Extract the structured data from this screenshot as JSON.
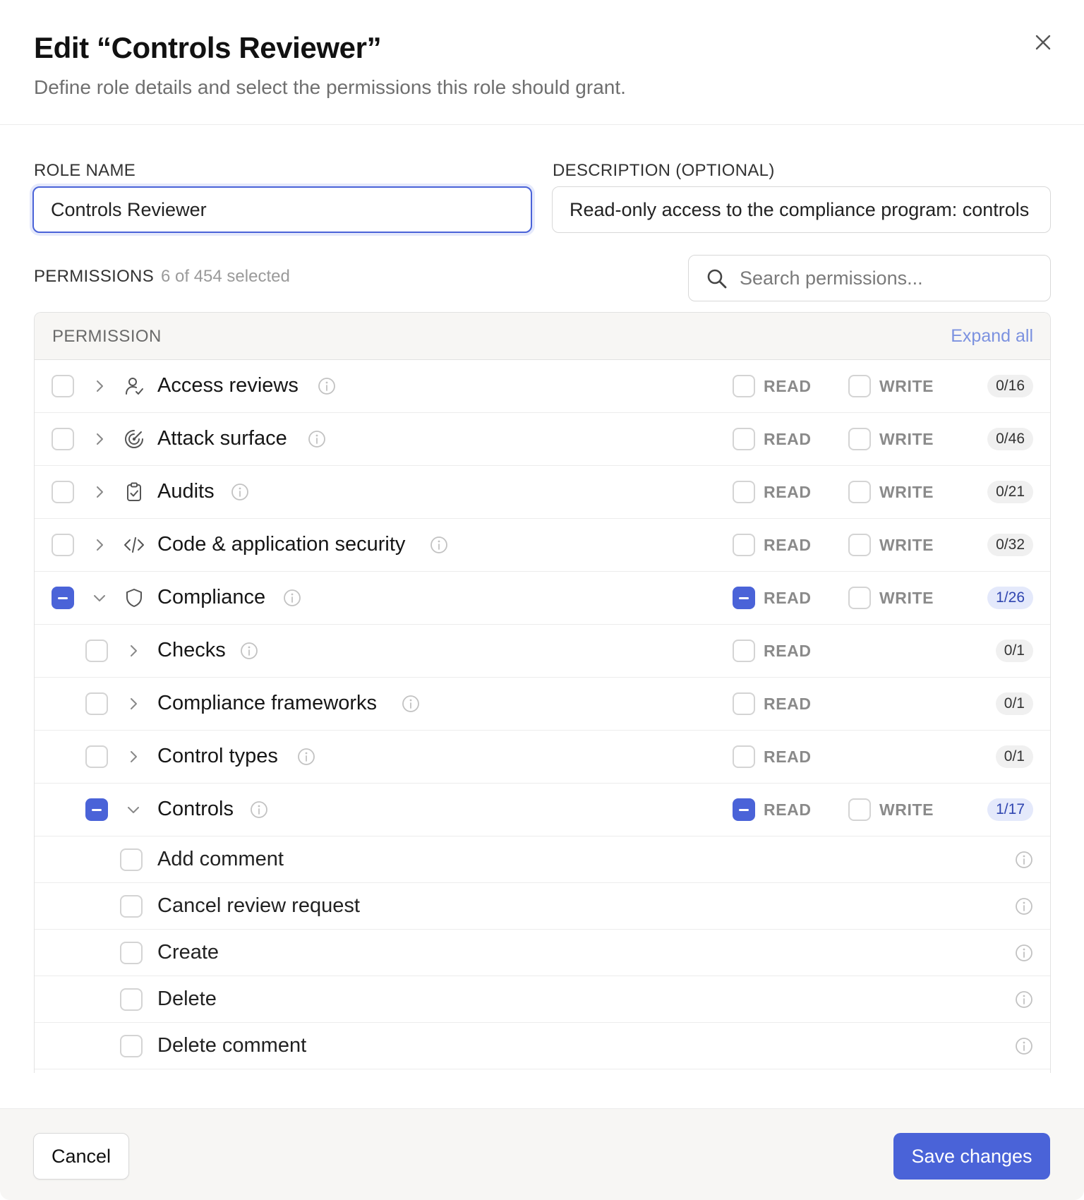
{
  "modal": {
    "title": "Edit “Controls Reviewer”",
    "subtitle": "Define role details and select the permissions this role should grant."
  },
  "form": {
    "role_name_label": "ROLE NAME",
    "role_name_value": "Controls Reviewer",
    "description_label": "DESCRIPTION (OPTIONAL)",
    "description_value": "Read-only access to the compliance program: controls"
  },
  "permissions": {
    "label": "PERMISSIONS",
    "selected_count": "6 of 454 selected",
    "search_placeholder": "Search permissions...",
    "column_header": "PERMISSION",
    "expand_all": "Expand all",
    "read_label": "READ",
    "write_label": "WRITE",
    "categories": [
      {
        "name": "Access reviews",
        "icon": "user-check-icon",
        "count": "0/16",
        "read": false,
        "write": false,
        "state": "unchecked"
      },
      {
        "name": "Attack surface",
        "icon": "radar-icon",
        "count": "0/46",
        "read": false,
        "write": false,
        "state": "unchecked"
      },
      {
        "name": "Audits",
        "icon": "clipboard-check-icon",
        "count": "0/21",
        "read": false,
        "write": false,
        "state": "unchecked"
      },
      {
        "name": "Code & application security",
        "icon": "code-icon",
        "count": "0/32",
        "read": false,
        "write": false,
        "state": "unchecked"
      },
      {
        "name": "Compliance",
        "icon": "shield-icon",
        "count": "1/26",
        "read": "partial",
        "write": false,
        "state": "partial",
        "expanded": true
      }
    ],
    "subcategories": [
      {
        "name": "Checks",
        "count": "0/1",
        "read": false,
        "state": "unchecked"
      },
      {
        "name": "Compliance frameworks",
        "count": "0/1",
        "read": false,
        "state": "unchecked"
      },
      {
        "name": "Control types",
        "count": "0/1",
        "read": false,
        "state": "unchecked"
      },
      {
        "name": "Controls",
        "count": "1/17",
        "read": "partial",
        "write": false,
        "state": "partial",
        "expanded": true
      }
    ],
    "leaf_permissions": [
      "Add comment",
      "Cancel review request",
      "Create",
      "Delete",
      "Delete comment"
    ]
  },
  "footer": {
    "cancel_label": "Cancel",
    "save_label": "Save changes"
  },
  "colors": {
    "accent": "#4a63d8",
    "link": "#7c92e0"
  }
}
